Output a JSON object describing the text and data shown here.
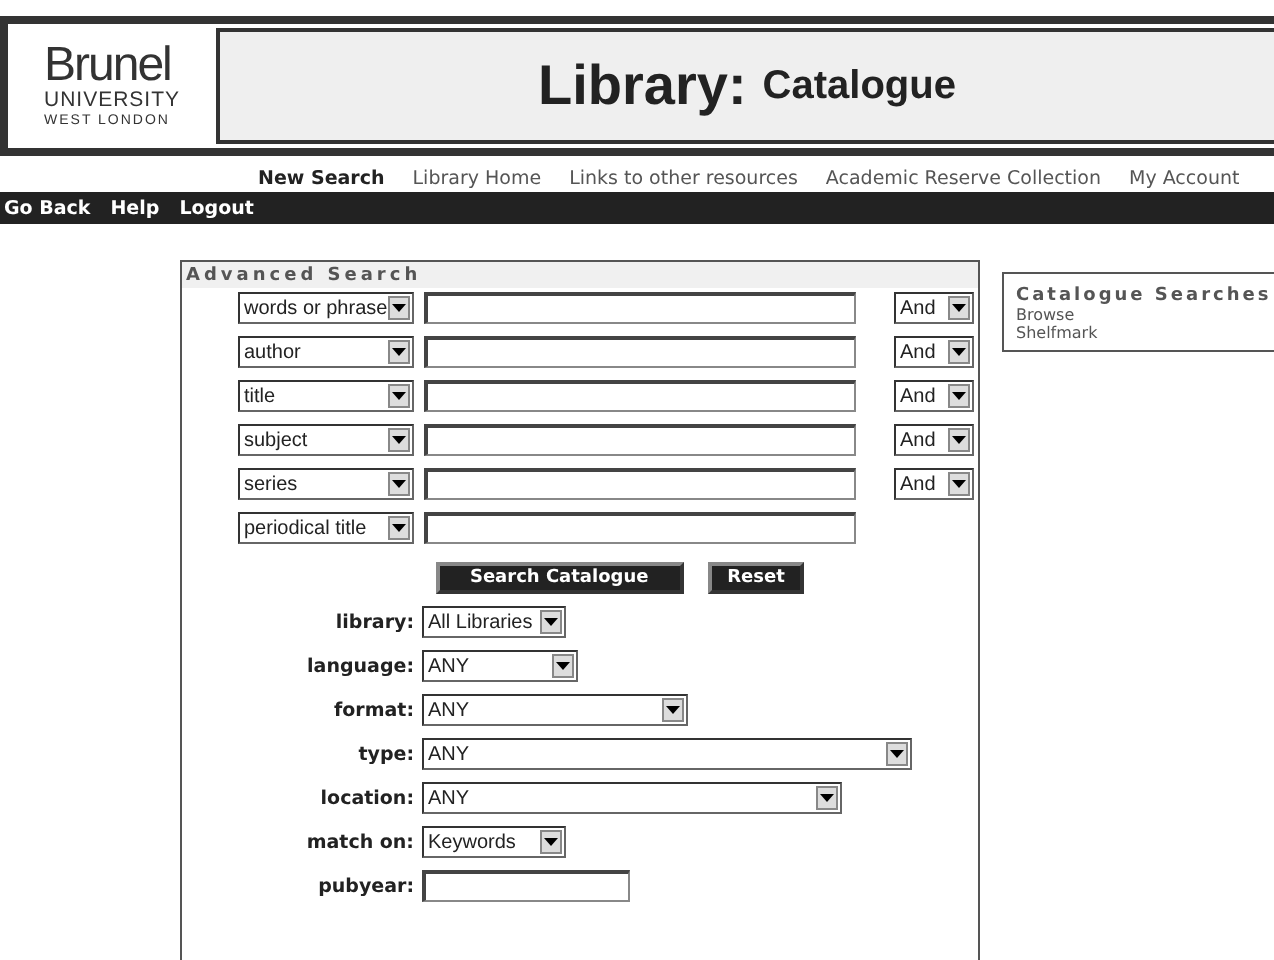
{
  "logo": {
    "name": "Brunel",
    "line_1": "UNIVERSITY",
    "line_2": "WEST LONDON"
  },
  "title": {
    "main": "Library:",
    "sub": "Catalogue"
  },
  "nav_links": [
    {
      "label": "New Search",
      "selected": true
    },
    {
      "label": "Library Home",
      "selected": false
    },
    {
      "label": "Links to other resources",
      "selected": false
    },
    {
      "label": "Academic Reserve Collection",
      "selected": false
    },
    {
      "label": "My Account",
      "selected": false
    }
  ],
  "toolbar": [
    "Go Back",
    "Help",
    "Logout"
  ],
  "advanced_search": {
    "heading": "Advanced Search",
    "rows": [
      {
        "field": "words or phrase",
        "operator": "And"
      },
      {
        "field": "author",
        "operator": "And"
      },
      {
        "field": "title",
        "operator": "And"
      },
      {
        "field": "subject",
        "operator": "And"
      },
      {
        "field": "series",
        "operator": "And"
      },
      {
        "field": "periodical title"
      }
    ],
    "buttons": [
      "Search Catalogue",
      "Reset"
    ],
    "filters": [
      {
        "label": "library:",
        "kind": "select",
        "value": "All Libraries"
      },
      {
        "label": "language:",
        "kind": "select",
        "value": "ANY"
      },
      {
        "label": "format:",
        "kind": "select",
        "value": "ANY"
      },
      {
        "label": "type:",
        "kind": "select",
        "value": "ANY"
      },
      {
        "label": "location:",
        "kind": "select",
        "value": "ANY"
      },
      {
        "label": "match on:",
        "kind": "select",
        "value": "Keywords"
      },
      {
        "label": "pubyear:",
        "kind": "text"
      }
    ]
  },
  "sidebar": {
    "heading": "Catalogue Searches",
    "links": [
      "Browse",
      "Shelfmark"
    ]
  }
}
